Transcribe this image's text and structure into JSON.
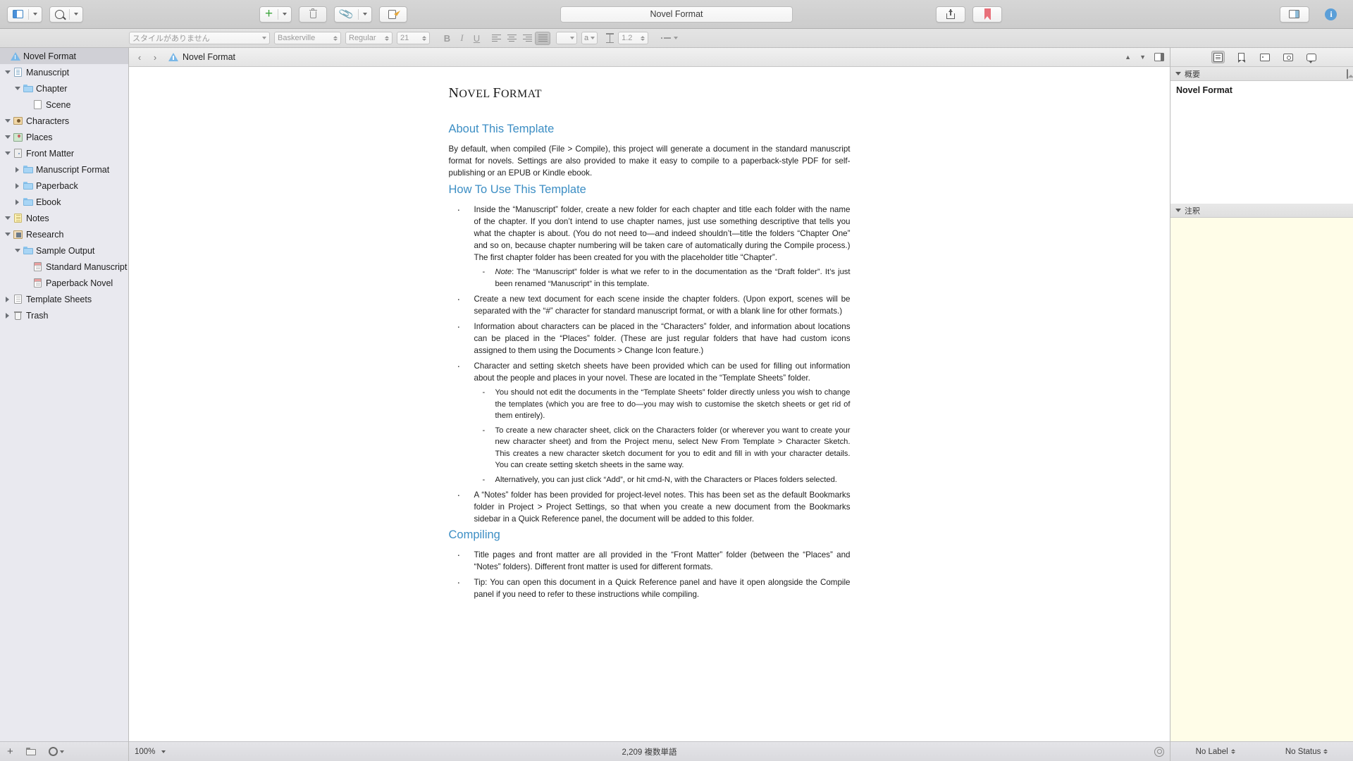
{
  "toolbar": {
    "sidebar_toggle": "sidebar-toggle",
    "search": "search",
    "add": "add",
    "trash": "move-to-trash",
    "link": "add-attachment",
    "compose": "composition-mode",
    "title": "Novel Format",
    "view_modes": [
      {
        "name": "document",
        "active": true
      },
      {
        "name": "corkboard",
        "active": false
      },
      {
        "name": "outliner",
        "active": false
      }
    ],
    "share": "share",
    "bookmark": "bookmarks",
    "inspector": "inspector-toggle",
    "info": "info"
  },
  "format_bar": {
    "style": "スタイルがありません",
    "font_family": "Baskerville",
    "font_style": "Regular",
    "font_size": "21",
    "bold": "B",
    "italic": "I",
    "underline": "U",
    "align": [
      "left",
      "center",
      "right",
      "justify"
    ],
    "align_selected": "justify",
    "text_color": "a",
    "line_spacing": "1.2"
  },
  "binder": {
    "items": [
      {
        "label": "Novel Format",
        "indent": 0,
        "icon": "project-icon",
        "disclosure": "none",
        "selected": true
      },
      {
        "label": "Manuscript",
        "indent": 0,
        "icon": "manuscript-icon",
        "disclosure": "expanded",
        "selected": false
      },
      {
        "label": "Chapter",
        "indent": 1,
        "icon": "folder-icon",
        "disclosure": "expanded",
        "selected": false
      },
      {
        "label": "Scene",
        "indent": 2,
        "icon": "document-icon",
        "disclosure": "none",
        "selected": false
      },
      {
        "label": "Characters",
        "indent": 0,
        "icon": "characters-icon",
        "disclosure": "expanded",
        "selected": false
      },
      {
        "label": "Places",
        "indent": 0,
        "icon": "places-icon",
        "disclosure": "expanded",
        "selected": false
      },
      {
        "label": "Front Matter",
        "indent": 0,
        "icon": "frontmatter-icon",
        "disclosure": "expanded",
        "selected": false
      },
      {
        "label": "Manuscript Format",
        "indent": 1,
        "icon": "folder-icon",
        "disclosure": "collapsed",
        "selected": false
      },
      {
        "label": "Paperback",
        "indent": 1,
        "icon": "folder-icon",
        "disclosure": "collapsed",
        "selected": false
      },
      {
        "label": "Ebook",
        "indent": 1,
        "icon": "folder-icon",
        "disclosure": "collapsed",
        "selected": false
      },
      {
        "label": "Notes",
        "indent": 0,
        "icon": "notes-icon",
        "disclosure": "expanded",
        "selected": false
      },
      {
        "label": "Research",
        "indent": 0,
        "icon": "research-icon",
        "disclosure": "expanded",
        "selected": false
      },
      {
        "label": "Sample Output",
        "indent": 1,
        "icon": "folder-icon",
        "disclosure": "expanded",
        "selected": false
      },
      {
        "label": "Standard Manuscript",
        "indent": 2,
        "icon": "pdf-icon",
        "disclosure": "none",
        "selected": false
      },
      {
        "label": "Paperback Novel",
        "indent": 2,
        "icon": "pdf-icon",
        "disclosure": "none",
        "selected": false
      },
      {
        "label": "Template Sheets",
        "indent": 0,
        "icon": "template-icon",
        "disclosure": "collapsed",
        "selected": false
      },
      {
        "label": "Trash",
        "indent": 0,
        "icon": "trash-icon",
        "disclosure": "collapsed",
        "selected": false
      }
    ],
    "footer": {
      "add": "add-item",
      "new_folder": "new-folder",
      "settings": "view-options"
    }
  },
  "editor": {
    "back": "‹",
    "forward": "›",
    "header_title": "Novel Format",
    "doc_title_part1": "N",
    "doc_title_part2": "OVEL ",
    "doc_title_part3": "F",
    "doc_title_part4": "ORMAT",
    "doc_title": "Novel Format",
    "sections": [
      {
        "heading": "About This Template",
        "paragraphs": [
          "By default, when compiled (File > Compile), this project will generate a document in the standard manuscript format for novels. Settings are also provided to make it easy to compile to a paperback-style PDF for self-publishing or an EPUB or Kindle ebook."
        ]
      }
    ],
    "how_to_heading": "How To Use This Template",
    "how_to_items": [
      {
        "text": "Inside the “Manuscript” folder, create a new folder for each chapter and title each folder with the name of the chapter. If you don’t intend to use chapter names, just use something descriptive that tells you what the chapter is about. (You do not need to—and indeed shouldn’t—title the folders “Chapter One” and so on, because chapter numbering will be taken care of automatically during the Compile process.) The first chapter folder has been created for you with the placeholder title “Chapter”.",
        "sub": [
          {
            "italic_lead": "Note",
            "text": ": The “Manuscript” folder is what we refer to in the documentation as the “Draft folder”. It’s just been renamed “Manuscript” in this template."
          }
        ]
      },
      {
        "text": "Create a new text document for each scene inside the chapter folders. (Upon export, scenes will be separated with the “#” character for standard manuscript format, or with a blank line for other formats.)",
        "sub": []
      },
      {
        "text": "Information about characters can be placed in the “Characters” folder, and information about locations can be placed in the “Places” folder. (These are just regular folders that have had custom icons assigned to them using the Documents > Change Icon feature.)",
        "sub": []
      },
      {
        "text": "Character and setting sketch sheets have been provided which can be used for filling out information about the people and places in your novel. These are located in the “Template Sheets” folder.",
        "sub": [
          {
            "italic_lead": "",
            "text": "You should not edit the documents in the “Template Sheets” folder directly unless you wish to change the templates (which you are free to do—you may wish to customise the sketch sheets or get rid of them entirely)."
          },
          {
            "italic_lead": "",
            "text": "To create a new character sheet, click on the Characters folder (or wherever you want to create your new character sheet) and from the Project menu, select New From Template > Character Sketch. This creates a new character sketch document for you to edit and fill in with your character details. You can create setting sketch sheets in the same way."
          },
          {
            "italic_lead": "",
            "text": "Alternatively, you can just click “Add”, or hit cmd-N, with the Characters or Places folders selected."
          }
        ]
      },
      {
        "text": "A “Notes” folder has been provided for project-level notes. This has been set as the default Bookmarks folder in Project > Project Settings, so that when you create a new document from the Bookmarks sidebar in a Quick Reference panel, the document will be added to this folder.",
        "sub": []
      }
    ],
    "compiling_heading": "Compiling",
    "compiling_items": [
      "Title pages and front matter are all provided in the “Front Matter” folder (between the “Places” and “Notes” folders). Different front matter is used for different formats.",
      "Tip: You can open this document in a Quick Reference panel and have it open alongside the Compile panel if you need to refer to these instructions while compiling."
    ],
    "footer": {
      "zoom": "100%",
      "word_count": "2,209 複数単語",
      "target": "writing-target"
    }
  },
  "inspector": {
    "tabs": [
      {
        "name": "notes-tab",
        "active": true
      },
      {
        "name": "bookmarks-tab",
        "active": false
      },
      {
        "name": "metadata-tab",
        "active": false
      },
      {
        "name": "snapshots-tab",
        "active": false
      },
      {
        "name": "comments-tab",
        "active": false
      }
    ],
    "synopsis_header": "概要",
    "synopsis_title": "Novel Format",
    "notes_header": "注釈",
    "footer": {
      "label": "No Label",
      "status": "No Status"
    }
  },
  "colors": {
    "accent_blue": "#3c8ec4",
    "folder_blue": "#a8d5f5",
    "corkboard_orange": "#e0a060",
    "outliner_blue": "#7fc5e0",
    "notes_yellow": "#fffde8",
    "bookmark_red": "#e8707a",
    "add_green": "#3ca53c"
  }
}
